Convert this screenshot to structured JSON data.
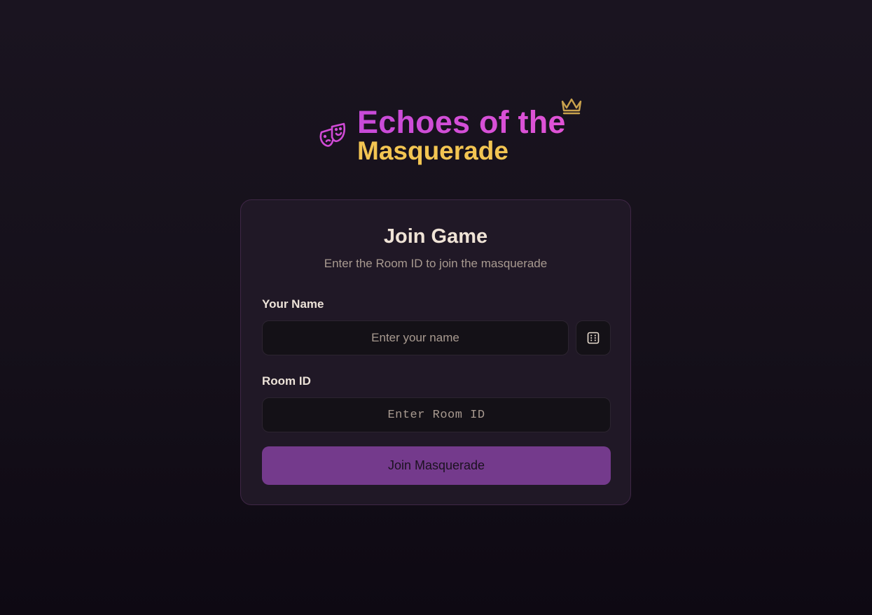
{
  "logo": {
    "title_line1": "Echoes of the",
    "title_line2": "Masquerade",
    "left_icon": "theater-mask-icon",
    "top_icon": "crown-icon"
  },
  "join_card": {
    "title": "Join Game",
    "subtitle": "Enter the Room ID to join the masquerade",
    "name_field": {
      "label": "Your Name",
      "value": "",
      "placeholder": "Enter your name"
    },
    "randomize_button": {
      "icon": "dice-icon"
    },
    "room_field": {
      "label": "Room ID",
      "value": "",
      "placeholder": "Enter Room ID"
    },
    "submit_label": "Join Masquerade"
  },
  "colors": {
    "background": "#16101b",
    "card_background": "#201826",
    "card_border": "#3f2746",
    "title_magenta": "#d94fd8",
    "title_gold": "#f3c552",
    "crown_gold": "#c9a24d",
    "button_purple": "#743a8c",
    "input_background": "#141117"
  }
}
